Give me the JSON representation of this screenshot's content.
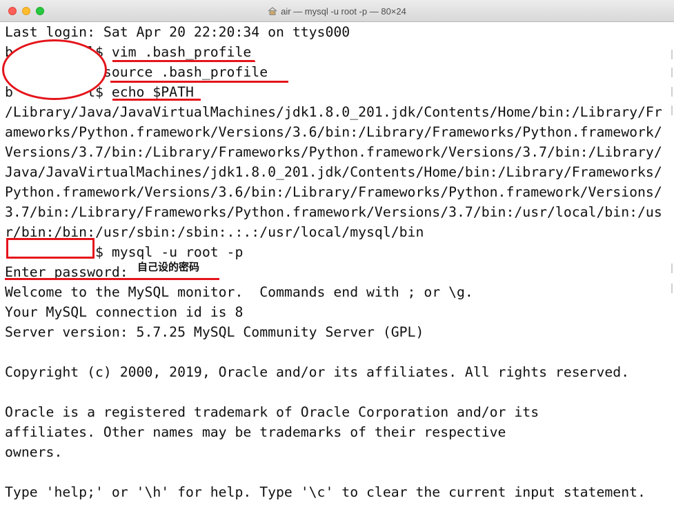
{
  "window": {
    "title": "air — mysql -u root -p — 80×24"
  },
  "terminal": {
    "lines": [
      "Last login: Sat Apr 20 22:20:34 on ttys000",
      "b         l$ vim .bash_profile",
      "            source .bash_profile",
      "b         l$ echo $PATH",
      "/Library/Java/JavaVirtualMachines/jdk1.8.0_201.jdk/Contents/Home/bin:/Library/Fr",
      "ameworks/Python.framework/Versions/3.6/bin:/Library/Frameworks/Python.framework/",
      "Versions/3.7/bin:/Library/Frameworks/Python.framework/Versions/3.7/bin:/Library/",
      "Java/JavaVirtualMachines/jdk1.8.0_201.jdk/Contents/Home/bin:/Library/Frameworks/",
      "Python.framework/Versions/3.6/bin:/Library/Frameworks/Python.framework/Versions/",
      "3.7/bin:/Library/Frameworks/Python.framework/Versions/3.7/bin:/usr/local/bin:/us",
      "r/bin:/bin:/usr/sbin:/sbin:.:.:/usr/local/mysql/bin",
      "           $ mysql -u root -p",
      "Enter password:",
      "Welcome to the MySQL monitor.  Commands end with ; or \\g.",
      "Your MySQL connection id is 8",
      "Server version: 5.7.25 MySQL Community Server (GPL)",
      "",
      "Copyright (c) 2000, 2019, Oracle and/or its affiliates. All rights reserved.",
      "",
      "Oracle is a registered trademark of Oracle Corporation and/or its",
      "affiliates. Other names may be trademarks of their respective",
      "owners.",
      "",
      "Type 'help;' or '\\h' for help. Type '\\c' to clear the current input statement."
    ]
  },
  "annotations": {
    "password_note": "自己设的密码",
    "color": "#e4141b"
  },
  "icons": {
    "title_icon": "home-icon"
  }
}
